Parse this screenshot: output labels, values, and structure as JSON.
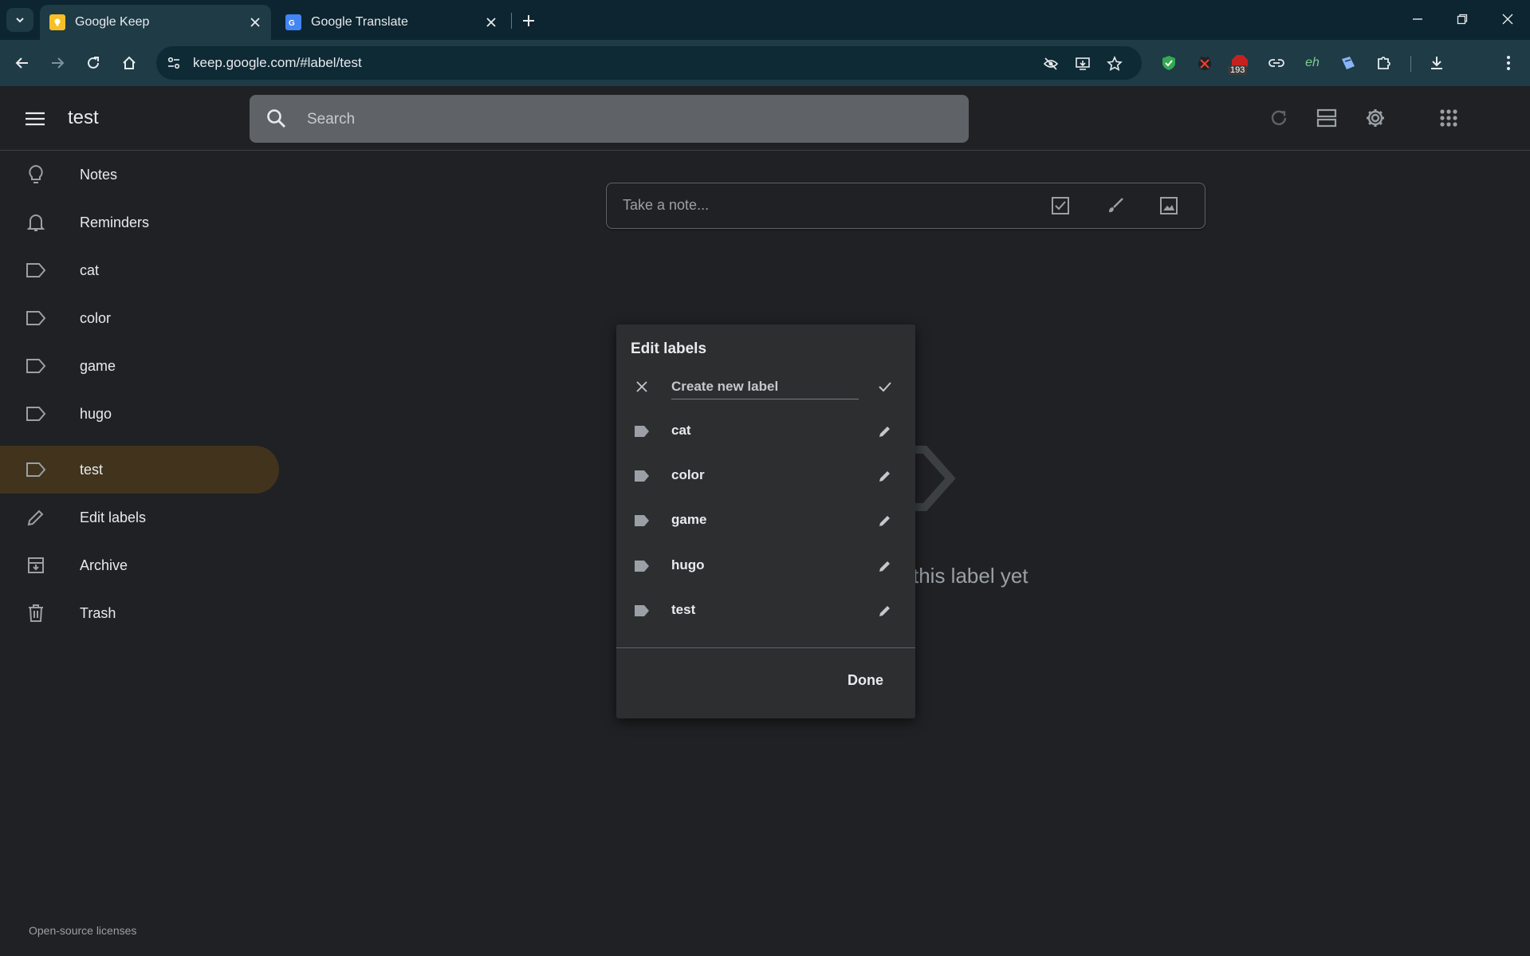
{
  "browser": {
    "tabs": [
      {
        "title": "Google Keep",
        "active": true
      },
      {
        "title": "Google Translate",
        "active": false
      }
    ],
    "url": "keep.google.com/#label/test",
    "extension_badge": "193",
    "extension_eh": "eh"
  },
  "header": {
    "title": "test",
    "search_placeholder": "Search"
  },
  "sidebar": {
    "items": [
      {
        "label": "Notes",
        "icon": "lightbulb-icon"
      },
      {
        "label": "Reminders",
        "icon": "bell-icon"
      },
      {
        "label": "cat",
        "icon": "label-icon"
      },
      {
        "label": "color",
        "icon": "label-icon"
      },
      {
        "label": "game",
        "icon": "label-icon"
      },
      {
        "label": "hugo",
        "icon": "label-icon"
      },
      {
        "label": "test",
        "icon": "label-icon",
        "active": true
      },
      {
        "label": "Edit labels",
        "icon": "pencil-icon"
      },
      {
        "label": "Archive",
        "icon": "archive-icon"
      },
      {
        "label": "Trash",
        "icon": "trash-icon"
      }
    ],
    "footer_link": "Open-source licenses"
  },
  "main": {
    "take_note_placeholder": "Take a note...",
    "empty_text": "this label yet"
  },
  "dialog": {
    "title": "Edit labels",
    "new_label_placeholder": "Create new label",
    "labels": [
      "cat",
      "color",
      "game",
      "hugo",
      "test"
    ],
    "done_label": "Done"
  },
  "colors": {
    "accent_active": "#41331c",
    "background": "#202124",
    "dialog": "#2d2e30"
  }
}
